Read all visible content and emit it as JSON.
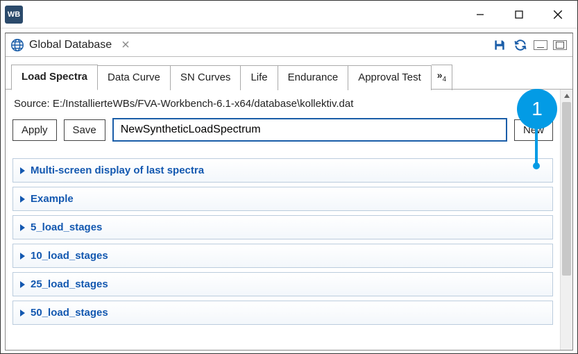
{
  "app_icon_text": "WB",
  "view": {
    "title": "Global Database",
    "close_glyph": "✕"
  },
  "tabs": {
    "items": [
      "Load Spectra",
      "Data Curve",
      "SN Curves",
      "Life",
      "Endurance",
      "Approval Test"
    ],
    "active_index": 0,
    "overflow_count": "4"
  },
  "source": {
    "label": "Source: E:/InstallierteWBs/FVA-Workbench-6.1-x64/database\\kollektiv.dat"
  },
  "actions": {
    "apply": "Apply",
    "save": "Save",
    "new": "New"
  },
  "name_input": {
    "value": "NewSyntheticLoadSpectrum"
  },
  "spectra": [
    "Multi-screen display of last spectra",
    "Example",
    "5_load_stages",
    "10_load_stages",
    "25_load_stages",
    "50_load_stages"
  ],
  "callout": {
    "number": "1"
  },
  "icons": {
    "save": "save-icon",
    "refresh": "refresh-icon"
  }
}
